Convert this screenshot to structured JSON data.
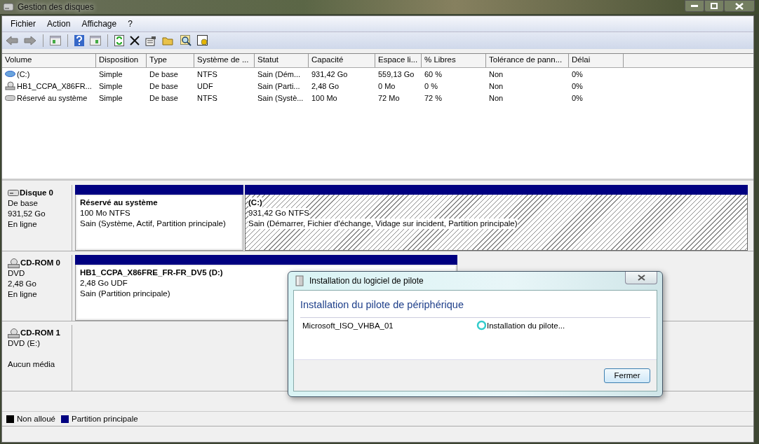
{
  "window": {
    "title": "Gestion des disques"
  },
  "menu": [
    "Fichier",
    "Action",
    "Affichage",
    "?"
  ],
  "volumes_table": {
    "columns": [
      "Volume",
      "Disposition",
      "Type",
      "Système de ...",
      "Statut",
      "Capacité",
      "Espace li...",
      "% Libres",
      "Tolérance de pann...",
      "Délai"
    ],
    "rows": [
      {
        "kind": "system",
        "cells": [
          "(C:)",
          "Simple",
          "De base",
          "NTFS",
          "Sain (Dém...",
          "931,42 Go",
          "559,13 Go",
          "60 %",
          "Non",
          "0%"
        ]
      },
      {
        "kind": "optical",
        "cells": [
          "HB1_CCPA_X86FR...",
          "Simple",
          "De base",
          "UDF",
          "Sain (Parti...",
          "2,48 Go",
          "0 Mo",
          "0 %",
          "Non",
          "0%"
        ]
      },
      {
        "kind": "plain",
        "cells": [
          "Réservé au système",
          "Simple",
          "De base",
          "NTFS",
          "Sain (Systè...",
          "100 Mo",
          "72 Mo",
          "72 %",
          "Non",
          "0%"
        ]
      }
    ]
  },
  "disks": [
    {
      "kind": "disk",
      "name": "Disque 0",
      "lines": [
        "De base",
        "931,52 Go"
      ],
      "status": "En ligne",
      "partitions": [
        {
          "name": "Réservé au système",
          "size": "100 Mo NTFS",
          "status": "Sain (Système, Actif, Partition principale)",
          "selected": false
        },
        {
          "name": "(C:)",
          "size": "931,42 Go NTFS",
          "status": "Sain (Démarrer, Fichier d'échange, Vidage sur incident, Partition principale)",
          "selected": true
        }
      ]
    },
    {
      "kind": "cdrom",
      "name": "CD-ROM 0",
      "lines": [
        "DVD",
        "2,48 Go"
      ],
      "status": "En ligne",
      "partitions": [
        {
          "name": "HB1_CCPA_X86FRE_FR-FR_DV5  (D:)",
          "size": "2,48 Go UDF",
          "status": "Sain (Partition principale)",
          "selected": false
        }
      ]
    },
    {
      "kind": "cdrom",
      "name": "CD-ROM 1",
      "lines": [
        "DVD (E:)"
      ],
      "status": "Aucun média"
    }
  ],
  "legend": [
    {
      "label": "Non alloué",
      "color": "#000000"
    },
    {
      "label": "Partition principale",
      "color": "#000080"
    }
  ],
  "dialog": {
    "title": "Installation du logiciel de pilote",
    "heading": "Installation du pilote de périphérique",
    "device": "Microsoft_ISO_VHBA_01",
    "status": "Installation du pilote...",
    "button": "Fermer"
  }
}
